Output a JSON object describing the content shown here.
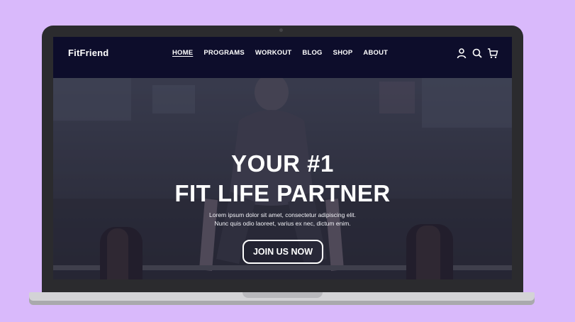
{
  "site": {
    "brand": "FitFriend",
    "nav": {
      "links": [
        "HOME",
        "PROGRAMS",
        "WORKOUT",
        "BLOG",
        "SHOP",
        "ABOUT"
      ],
      "active": "HOME",
      "icons": [
        "user-icon",
        "search-icon",
        "cart-icon"
      ]
    },
    "hero": {
      "title_line1": "YOUR #1",
      "title_line2": "FIT LIFE PARTNER",
      "subtitle_line1": "Lorem ipsum dolor sit amet, consectetur adipiscing elit.",
      "subtitle_line2": "Nunc quis odio laoreet, varius ex nec, dictum enim.",
      "cta_label": "JOIN US NOW"
    }
  },
  "colors": {
    "background": "#d9b9fb",
    "nav_bg": "#0d0d2b",
    "hero_overlay": "#2a2a45",
    "text": "#ffffff"
  }
}
